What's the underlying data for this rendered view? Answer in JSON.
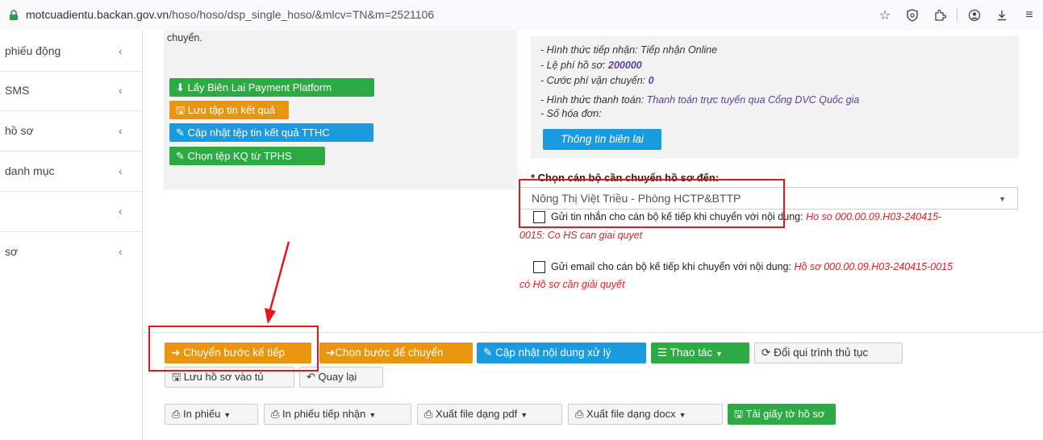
{
  "browser": {
    "url_host": "motcuadientu.backan.gov.vn",
    "url_path": "/hoso/hoso/dsp_single_hoso/&mlcv=TN&m=2521106"
  },
  "sidebar": {
    "items": [
      {
        "label": "phiếu động"
      },
      {
        "label": "SMS"
      },
      {
        "label": "hồ sơ"
      },
      {
        "label": "danh mục"
      },
      {
        "label": ""
      },
      {
        "label": "sơ"
      }
    ]
  },
  "left_panel": {
    "top_text": "chuyển.",
    "buttons": {
      "bien_lai": "Lấy Biên Lai Payment Platform",
      "luu_tap_tin": "Lưu tập tin kết quả",
      "cap_nhat_tep": "Cập nhật tệp tin kết quả TTHC",
      "chon_tep": "Chọn tệp KQ từ TPHS"
    }
  },
  "info": {
    "hinh_thuc_label": "- Hình thức tiếp nhận:",
    "hinh_thuc_value": "Tiếp nhận Online",
    "le_phi_label": "- Lệ phí hồ sơ:",
    "le_phi_value": "200000",
    "cuoc_phi_label": "- Cước phí vận chuyển:",
    "cuoc_phi_value": "0",
    "thanh_toan_label": "- Hình thức thanh toán:",
    "thanh_toan_value": "Thanh toán trực tuyến qua Cổng DVC Quốc gia",
    "so_hoa_don_label": "- Số hóa đơn:",
    "bien_lai_button": "Thông tin biên lai"
  },
  "transfer": {
    "label": "* Chọn cán bộ cần chuyển hồ sơ đến:",
    "selected": "Nông Thị Việt Triều - Phòng HCTP&BTTP",
    "sms_label": "Gửi tin nhắn cho cán bộ kế tiếp khi chuyển với nội dung:",
    "sms_content_1": "Ho so 000.00.09.H03-240415-",
    "sms_content_2": "0015: Co HS can giai quyet",
    "email_label": "Gửi email cho cán bộ kế tiếp khi chuyển với nội dung:",
    "email_content_1": "Hồ sơ 000.00.09.H03-240415-0015",
    "email_content_2": "có Hồ sơ cần giải quyết"
  },
  "actions": {
    "chuyen_buoc": "Chuyển bước kế tiếp",
    "chon_buoc": "Chọn bước để chuyển",
    "cap_nhat_noi_dung": "Cập nhật nội dung xử lý",
    "thao_tac": "Thao tác",
    "doi_qui_trinh": "Đổi qui trình thủ tục",
    "luu_ho_so": "Lưu hồ sơ vào tủ",
    "quay_lai": "Quay lại"
  },
  "print_bar": {
    "in_phieu": "In phiếu",
    "in_phieu_tiep_nhan": "In phiếu tiếp nhận",
    "xuat_pdf": "Xuất file dạng pdf",
    "xuat_docx": "Xuất file dạng docx",
    "tai_giay_to": "Tải giấy tờ hồ sơ"
  },
  "colors": {
    "green": "#2eaa44",
    "orange": "#e8960f",
    "blue": "#1a9be0",
    "annotation_red": "#e8161b"
  }
}
